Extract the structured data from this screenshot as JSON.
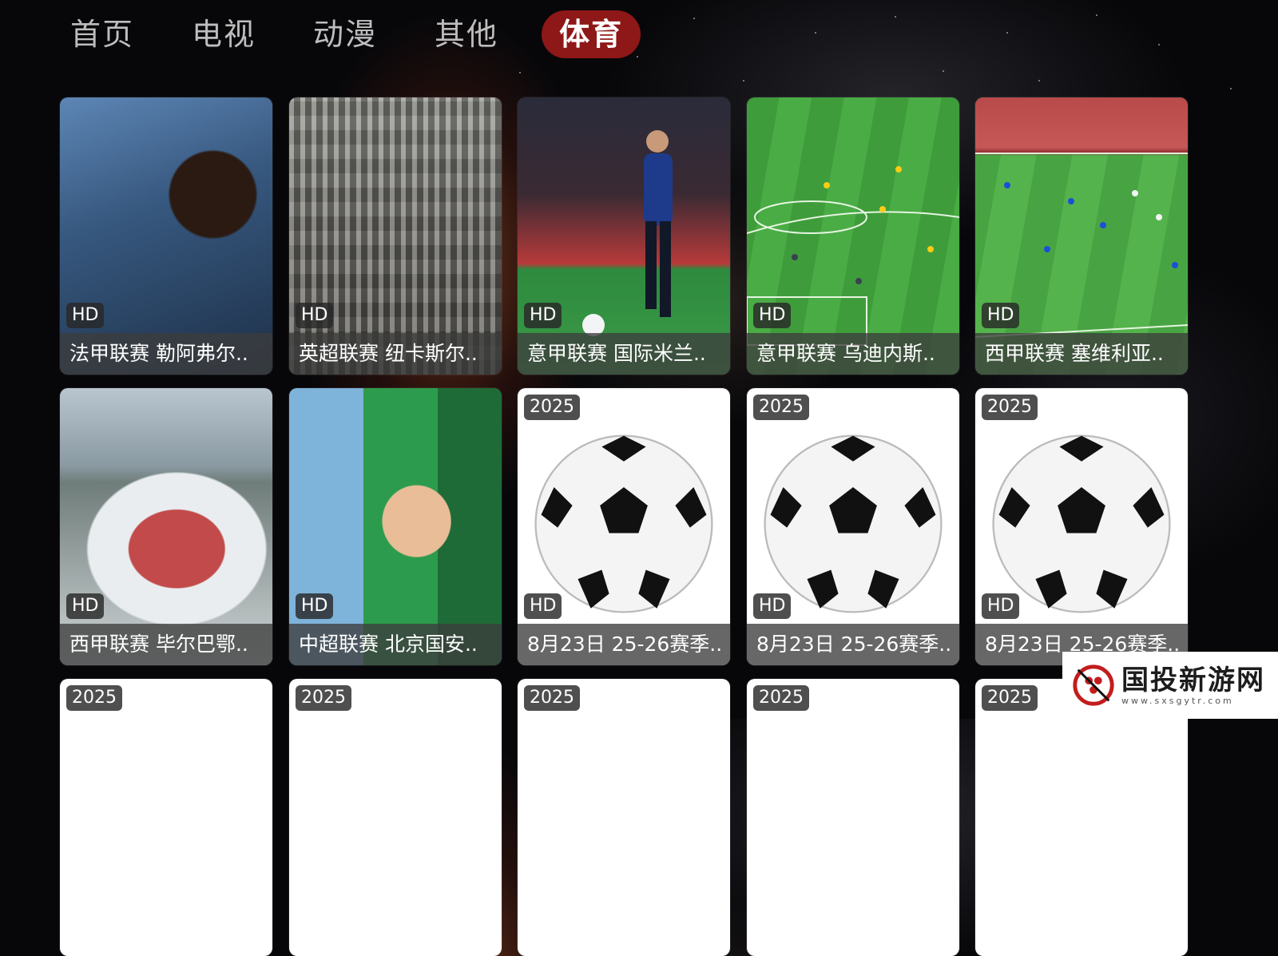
{
  "nav": {
    "tabs": [
      {
        "label": "首页",
        "active": false
      },
      {
        "label": "电视",
        "active": false
      },
      {
        "label": "动漫",
        "active": false
      },
      {
        "label": "其他",
        "active": false
      },
      {
        "label": "体育",
        "active": true
      }
    ],
    "active_color": "#8e1717"
  },
  "grid": {
    "row1": [
      {
        "title": "法甲联赛 勒阿弗尔..",
        "badge": "HD",
        "thumb": "crowd-photo"
      },
      {
        "title": "英超联赛 纽卡斯尔..",
        "badge": "HD",
        "thumb": "stands-photo"
      },
      {
        "title": "意甲联赛 国际米兰..",
        "badge": "HD",
        "thumb": "player-photo"
      },
      {
        "title": "意甲联赛 乌迪内斯..",
        "badge": "HD",
        "thumb": "pitch-photo"
      },
      {
        "title": "西甲联赛 塞维利亚..",
        "badge": "HD",
        "thumb": "pitch-photo"
      }
    ],
    "row2": [
      {
        "title": "西甲联赛 毕尔巴鄂..",
        "badge": "HD",
        "thumb": "stadium-photo"
      },
      {
        "title": "中超联赛 北京国安..",
        "badge": "HD",
        "thumb": "fans-photo"
      },
      {
        "title": "8月23日 25-26赛季..",
        "badge": "HD",
        "year": "2025",
        "thumb": "soccer-ball-icon"
      },
      {
        "title": "8月23日 25-26赛季..",
        "badge": "HD",
        "year": "2025",
        "thumb": "soccer-ball-icon"
      },
      {
        "title": "8月23日 25-26赛季..",
        "badge": "HD",
        "year": "2025",
        "thumb": "soccer-ball-icon"
      }
    ],
    "row3": [
      {
        "year": "2025"
      },
      {
        "year": "2025"
      },
      {
        "year": "2025"
      },
      {
        "year": "2025"
      },
      {
        "year": "2025"
      }
    ]
  },
  "watermark": {
    "title": "国投新游网",
    "url": "www.sxsgytr.com"
  }
}
